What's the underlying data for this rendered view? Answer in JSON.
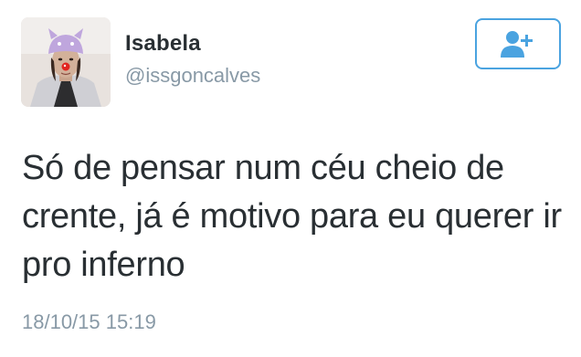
{
  "user": {
    "display_name": "Isabela",
    "handle": "@issgoncalves",
    "avatar_icon": "profile-photo"
  },
  "follow_button": {
    "icon": "add-user-icon",
    "color": "#4aa3e0"
  },
  "tweet": {
    "text": "Só de pensar num céu cheio de crente, já é motivo para eu querer ir pro inferno",
    "timestamp": "18/10/15 15:19"
  },
  "colors": {
    "text": "#292f33",
    "secondary": "#8899a6",
    "accent": "#4aa3e0"
  }
}
